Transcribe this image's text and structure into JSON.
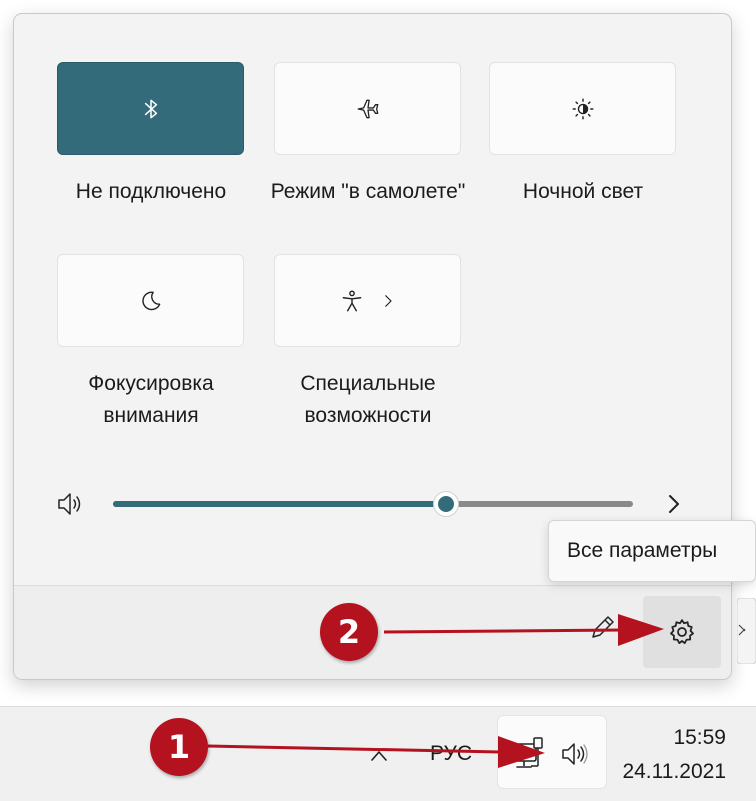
{
  "quick_settings": {
    "tiles": [
      {
        "label": "Не подключено",
        "icon": "bluetooth-icon",
        "active": true
      },
      {
        "label": "Режим \"в самолете\"",
        "icon": "airplane-icon",
        "active": false
      },
      {
        "label": "Ночной свет",
        "icon": "night-light-icon",
        "active": false
      },
      {
        "label": "Фокусировка внимания",
        "icon": "focus-moon-icon",
        "active": false
      },
      {
        "label": "Специальные возможности",
        "icon": "accessibility-icon",
        "active": false,
        "has_chevron": true
      }
    ],
    "volume": {
      "level_percent": 64,
      "icon": "speaker-icon"
    },
    "tooltip": "Все параметры",
    "footer": {
      "edit_icon": "pencil-icon",
      "settings_icon": "gear-icon"
    }
  },
  "taskbar": {
    "language": "РУС",
    "time": "15:59",
    "date": "24.11.2021",
    "icons": [
      "chevron-up-icon",
      "network-icon",
      "speaker-icon"
    ]
  },
  "annotations": {
    "markers": [
      "1",
      "2"
    ],
    "color": "#b3121e"
  },
  "colors": {
    "accent": "#336b7a",
    "panel_bg": "#f3f3f3"
  }
}
